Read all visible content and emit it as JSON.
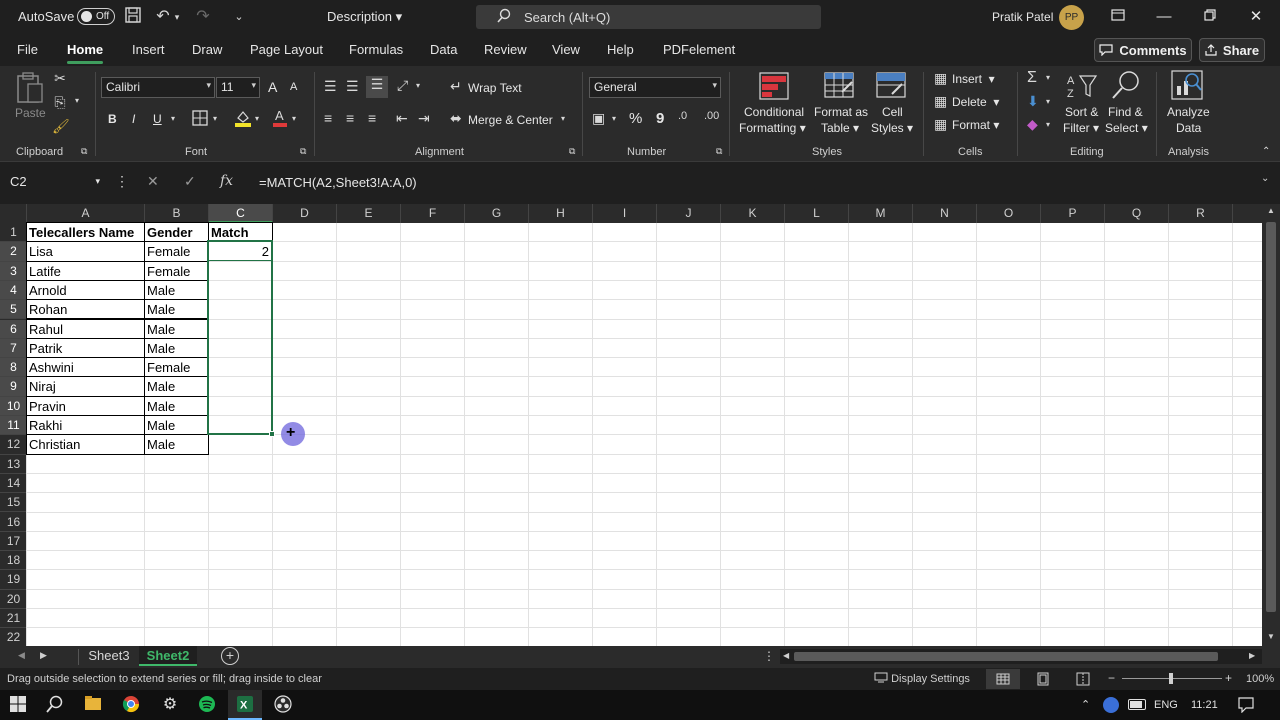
{
  "titlebar": {
    "autosave_label": "AutoSave",
    "autosave_state": "Off",
    "document_title": "Description",
    "search_placeholder": "Search (Alt+Q)",
    "user_name": "Pratik Patel",
    "user_initials": "PP"
  },
  "menu": {
    "tabs": [
      "File",
      "Home",
      "Insert",
      "Draw",
      "Page Layout",
      "Formulas",
      "Data",
      "Review",
      "View",
      "Help",
      "PDFelement"
    ],
    "active_tab": "Home",
    "comments_label": "Comments",
    "share_label": "Share"
  },
  "ribbon": {
    "clipboard": {
      "paste_label": "Paste",
      "group_label": "Clipboard"
    },
    "font": {
      "font_name": "Calibri",
      "font_size": "11",
      "group_label": "Font",
      "bold": "B",
      "italic": "I",
      "underline": "U",
      "grow": "A",
      "shrink": "A"
    },
    "alignment": {
      "wrap_text": "Wrap Text",
      "merge_center": "Merge & Center",
      "group_label": "Alignment"
    },
    "number": {
      "format": "General",
      "group_label": "Number",
      "percent": "%",
      "comma": "9"
    },
    "styles": {
      "conditional_formatting_line1": "Conditional",
      "conditional_formatting_line2": "Formatting",
      "format_table_line1": "Format as",
      "format_table_line2": "Table",
      "cell_styles_line1": "Cell",
      "cell_styles_line2": "Styles",
      "group_label": "Styles"
    },
    "cells": {
      "insert": "Insert",
      "delete": "Delete",
      "format": "Format",
      "group_label": "Cells"
    },
    "editing": {
      "sort_filter_line1": "Sort &",
      "sort_filter_line2": "Filter",
      "find_select_line1": "Find &",
      "find_select_line2": "Select",
      "group_label": "Editing"
    },
    "analysis": {
      "analyze_line1": "Analyze",
      "analyze_line2": "Data",
      "group_label": "Analysis"
    }
  },
  "formula_bar": {
    "name_box": "C2",
    "formula": "=MATCH(A2,Sheet3!A:A,0)",
    "fx": "fx"
  },
  "sheet": {
    "columns": [
      "A",
      "B",
      "C",
      "D",
      "E",
      "F",
      "G",
      "H",
      "I",
      "J",
      "K",
      "L",
      "M",
      "N",
      "O",
      "P",
      "Q",
      "R"
    ],
    "rows": [
      "1",
      "2",
      "3",
      "4",
      "5",
      "6",
      "7",
      "8",
      "9",
      "10",
      "11",
      "12",
      "13",
      "14",
      "15",
      "16",
      "17",
      "18",
      "19",
      "20",
      "21",
      "22"
    ],
    "header": [
      "Telecallers Name",
      "Gender",
      "Match"
    ],
    "data": [
      [
        "Lisa",
        "Female",
        "2"
      ],
      [
        "Latife",
        "Female",
        ""
      ],
      [
        "Arnold",
        "Male",
        ""
      ],
      [
        "Rohan",
        "Male",
        ""
      ],
      [
        "Rahul",
        "Male",
        ""
      ],
      [
        "Patrik",
        "Male",
        ""
      ],
      [
        "Ashwini",
        "Female",
        ""
      ],
      [
        "Niraj",
        "Male",
        ""
      ],
      [
        "Pravin",
        "Male",
        ""
      ],
      [
        "Rakhi",
        "Male",
        ""
      ],
      [
        "Christian",
        "Male",
        ""
      ]
    ]
  },
  "sheet_tabs": [
    "Sheet3",
    "Sheet2"
  ],
  "active_sheet": "Sheet2",
  "status": {
    "message": "Drag outside selection to extend series or fill; drag inside to clear",
    "display_settings": "Display Settings",
    "zoom": "100%"
  },
  "taskbar": {
    "language": "ENG",
    "time": "11:21"
  },
  "colors": {
    "accent_green": "#217346",
    "tab_green": "#3fb86a",
    "ribbon_bg": "#2b2b2b",
    "cursor_highlight": "#6e64dc"
  }
}
